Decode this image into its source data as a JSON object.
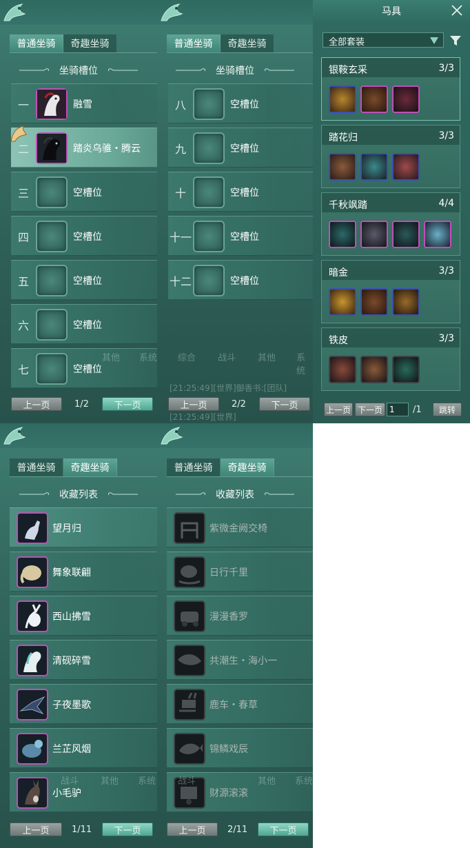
{
  "p1": {
    "tabs": [
      "普通坐骑",
      "奇趣坐骑"
    ],
    "active_tab": 0,
    "section": "坐骑槽位",
    "rows": [
      {
        "num": "一",
        "name": "融雪",
        "filled": true,
        "selected": false
      },
      {
        "num": "二",
        "name": "踏炎乌骓・腾云",
        "filled": true,
        "selected": true
      },
      {
        "num": "三",
        "name": "空槽位",
        "filled": false,
        "selected": false
      },
      {
        "num": "四",
        "name": "空槽位",
        "filled": false,
        "selected": false
      },
      {
        "num": "五",
        "name": "空槽位",
        "filled": false,
        "selected": false
      },
      {
        "num": "六",
        "name": "空槽位",
        "filled": false,
        "selected": false
      },
      {
        "num": "七",
        "name": "空槽位",
        "filled": false,
        "selected": false
      }
    ],
    "prev": "上一页",
    "page": "1/2",
    "next": "下一页",
    "ghost": [
      "其他",
      "系统"
    ]
  },
  "p2": {
    "tabs": [
      "普通坐骑",
      "奇趣坐骑"
    ],
    "active_tab": 0,
    "section": "坐骑槽位",
    "rows": [
      {
        "num": "八",
        "name": "空槽位"
      },
      {
        "num": "九",
        "name": "空槽位"
      },
      {
        "num": "十",
        "name": "空槽位"
      },
      {
        "num": "十一",
        "name": "空槽位"
      },
      {
        "num": "十二",
        "name": "空槽位"
      }
    ],
    "prev": "上一页",
    "page": "2/2",
    "next": "下一页",
    "ghost": [
      "综合",
      "战斗",
      "其他",
      "系统"
    ],
    "ghost_chat": [
      "[21:25:49][世界]御香书:[团队]",
      "[21:25:49][世界]"
    ]
  },
  "p3": {
    "title": "马具",
    "filter": "全部套装",
    "sets": [
      {
        "name": "银鞍玄采",
        "count": "3/3",
        "items": [
          "saddle-gold",
          "saddle-brown",
          "barding-purple"
        ]
      },
      {
        "name": "踏花归",
        "count": "3/3",
        "items": [
          "saddle-leather",
          "bridle-red",
          "armor-red"
        ]
      },
      {
        "name": "千秋飒踏",
        "count": "4/4",
        "items": [
          "bridle-dark",
          "saddle-dark",
          "armor-dark",
          "barding-cyan"
        ]
      },
      {
        "name": "暗金",
        "count": "3/3",
        "items": [
          "saddle-gold",
          "saddle-brown",
          "barding-brown"
        ]
      },
      {
        "name": "铁皮",
        "count": "3/3",
        "items": [
          "armor-brown",
          "saddle-leather",
          "bridle-dark"
        ]
      }
    ],
    "prev": "上一页",
    "next": "下一页",
    "page_input": "1",
    "page_total": "/1",
    "jump": "跳转"
  },
  "p4": {
    "tabs": [
      "普通坐骑",
      "奇趣坐骑"
    ],
    "active_tab": 1,
    "section": "收藏列表",
    "items": [
      "望月归",
      "舞象联翩",
      "西山拂雪",
      "清砚碎雪",
      "子夜墨歌",
      "兰芷风烟",
      "小毛驴"
    ],
    "prev": "上一页",
    "page": "1/11",
    "next": "下一页",
    "ghost": [
      "战斗",
      "其他",
      "系统"
    ]
  },
  "p5": {
    "tabs": [
      "普通坐骑",
      "奇趣坐骑"
    ],
    "active_tab": 1,
    "section": "收藏列表",
    "items": [
      "紫微金阙交椅",
      "日行千里",
      "漫漫香罗",
      "共潮生・海小一",
      "鹿车・春草",
      "锦鳞戏辰",
      "财源滚滚"
    ],
    "prev": "上一页",
    "page": "2/11",
    "next": "下一页",
    "ghost": [
      "战斗",
      "其他",
      "系统"
    ]
  }
}
